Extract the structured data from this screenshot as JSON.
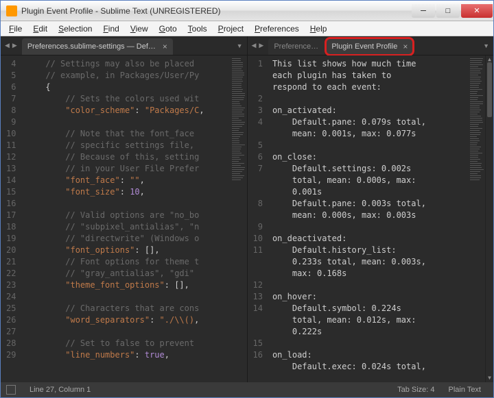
{
  "window": {
    "title": "Plugin Event Profile - Sublime Text (UNREGISTERED)"
  },
  "menu": [
    "File",
    "Edit",
    "Selection",
    "Find",
    "View",
    "Goto",
    "Tools",
    "Project",
    "Preferences",
    "Help"
  ],
  "left_tab": {
    "label": "Preferences.sublime-settings — Default"
  },
  "right_tab_inactive": {
    "label": "Preferences.su"
  },
  "right_tab_active": {
    "label": "Plugin Event Profile"
  },
  "left_gutter": [
    "4",
    "5",
    "6",
    "7",
    "8",
    "9",
    "10",
    "11",
    "12",
    "13",
    "14",
    "15",
    "16",
    "17",
    "18",
    "19",
    "20",
    "21",
    "22",
    "23",
    "24",
    "25",
    "26",
    "27",
    "28",
    "29"
  ],
  "left_lines": [
    {
      "indent": 1,
      "type": "comment",
      "text": "// Settings may also be placed "
    },
    {
      "indent": 1,
      "type": "comment",
      "text": "// example, in Packages/User/Py"
    },
    {
      "indent": 1,
      "type": "punc",
      "text": "{"
    },
    {
      "indent": 2,
      "type": "comment",
      "text": "// Sets the colors used wit"
    },
    {
      "indent": 2,
      "type": "kv",
      "key": "\"color_scheme\"",
      "val": "\"Packages/C",
      "valtype": "string"
    },
    {
      "indent": 2,
      "type": "blank",
      "text": ""
    },
    {
      "indent": 2,
      "type": "comment",
      "text": "// Note that the font_face "
    },
    {
      "indent": 2,
      "type": "comment",
      "text": "// specific settings file, "
    },
    {
      "indent": 2,
      "type": "comment",
      "text": "// Because of this, setting"
    },
    {
      "indent": 2,
      "type": "comment",
      "text": "// in your User File Prefer"
    },
    {
      "indent": 2,
      "type": "kv",
      "key": "\"font_face\"",
      "val": "\"\"",
      "valtype": "string"
    },
    {
      "indent": 2,
      "type": "kv",
      "key": "\"font_size\"",
      "val": "10",
      "valtype": "num"
    },
    {
      "indent": 2,
      "type": "blank",
      "text": ""
    },
    {
      "indent": 2,
      "type": "comment",
      "text": "// Valid options are \"no_bo"
    },
    {
      "indent": 2,
      "type": "comment",
      "text": "// \"subpixel_antialias\", \"n"
    },
    {
      "indent": 2,
      "type": "comment",
      "text": "// \"directwrite\" (Windows o"
    },
    {
      "indent": 2,
      "type": "kv",
      "key": "\"font_options\"",
      "val": "[]",
      "valtype": "punc"
    },
    {
      "indent": 2,
      "type": "comment",
      "text": "// Font options for theme t"
    },
    {
      "indent": 2,
      "type": "comment",
      "text": "// \"gray_antialias\", \"gdi\" "
    },
    {
      "indent": 2,
      "type": "kv",
      "key": "\"theme_font_options\"",
      "val": "[]",
      "valtype": "punc"
    },
    {
      "indent": 2,
      "type": "blank",
      "text": ""
    },
    {
      "indent": 2,
      "type": "comment",
      "text": "// Characters that are cons"
    },
    {
      "indent": 2,
      "type": "kv",
      "key": "\"word_separators\"",
      "val": "\"./\\\\()",
      "valtype": "string"
    },
    {
      "indent": 2,
      "type": "blank",
      "text": ""
    },
    {
      "indent": 2,
      "type": "comment",
      "text": "// Set to false to prevent "
    },
    {
      "indent": 2,
      "type": "kv",
      "key": "\"line_numbers\"",
      "val": "true",
      "valtype": "bool",
      "trail": ","
    }
  ],
  "right_gutter": [
    "1",
    "",
    "",
    "2",
    "3",
    "4",
    "",
    "5",
    "6",
    "7",
    "",
    "",
    "8",
    "",
    "9",
    "10",
    "11",
    "",
    "",
    "12",
    "13",
    "14",
    "",
    "",
    "15",
    "16"
  ],
  "right_lines": [
    "This list shows how much time",
    "each plugin has taken to",
    "respond to each event:",
    "",
    "on_activated:",
    "    Default.pane: 0.079s total,",
    "    mean: 0.001s, max: 0.077s",
    "",
    "on_close:",
    "    Default.settings: 0.002s",
    "    total, mean: 0.000s, max:",
    "    0.001s",
    "    Default.pane: 0.003s total,",
    "    mean: 0.000s, max: 0.003s",
    "",
    "on_deactivated:",
    "    Default.history_list:",
    "    0.233s total, mean: 0.003s,",
    "    max: 0.168s",
    "",
    "on_hover:",
    "    Default.symbol: 0.224s",
    "    total, mean: 0.012s, max:",
    "    0.222s",
    "",
    "on_load:",
    "    Default.exec: 0.024s total,"
  ],
  "status": {
    "cursor": "Line 27, Column 1",
    "tab_size": "Tab Size: 4",
    "syntax": "Plain Text"
  }
}
